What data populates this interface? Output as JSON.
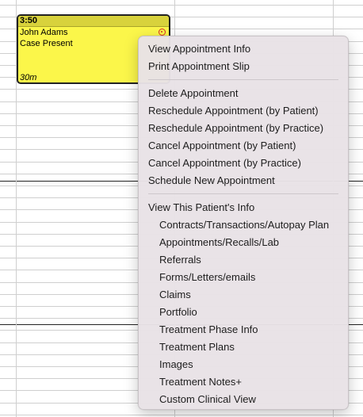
{
  "appointment": {
    "time": "3:50",
    "patient_name": "John Adams",
    "type": "Case Present",
    "duration": "30m",
    "color": "#fbf64a",
    "status_icon": "red-circle-icon"
  },
  "context_menu": {
    "group1": [
      {
        "label": "View Appointment Info"
      },
      {
        "label": "Print Appointment Slip"
      }
    ],
    "group2": [
      {
        "label": "Delete Appointment"
      },
      {
        "label": "Reschedule Appointment (by Patient)"
      },
      {
        "label": "Reschedule Appointment (by Practice)"
      },
      {
        "label": "Cancel Appointment (by Patient)"
      },
      {
        "label": "Cancel Appointment (by Practice)"
      },
      {
        "label": "Schedule New Appointment"
      }
    ],
    "group3_header": "View This Patient's Info",
    "group3": [
      {
        "label": "Contracts/Transactions/Autopay Plan"
      },
      {
        "label": "Appointments/Recalls/Lab"
      },
      {
        "label": "Referrals"
      },
      {
        "label": "Forms/Letters/emails"
      },
      {
        "label": "Claims"
      },
      {
        "label": "Portfolio"
      },
      {
        "label": "Treatment Phase Info"
      },
      {
        "label": "Treatment Plans"
      },
      {
        "label": "Images"
      },
      {
        "label": "Treatment Notes+"
      },
      {
        "label": "Custom Clinical View"
      }
    ]
  }
}
